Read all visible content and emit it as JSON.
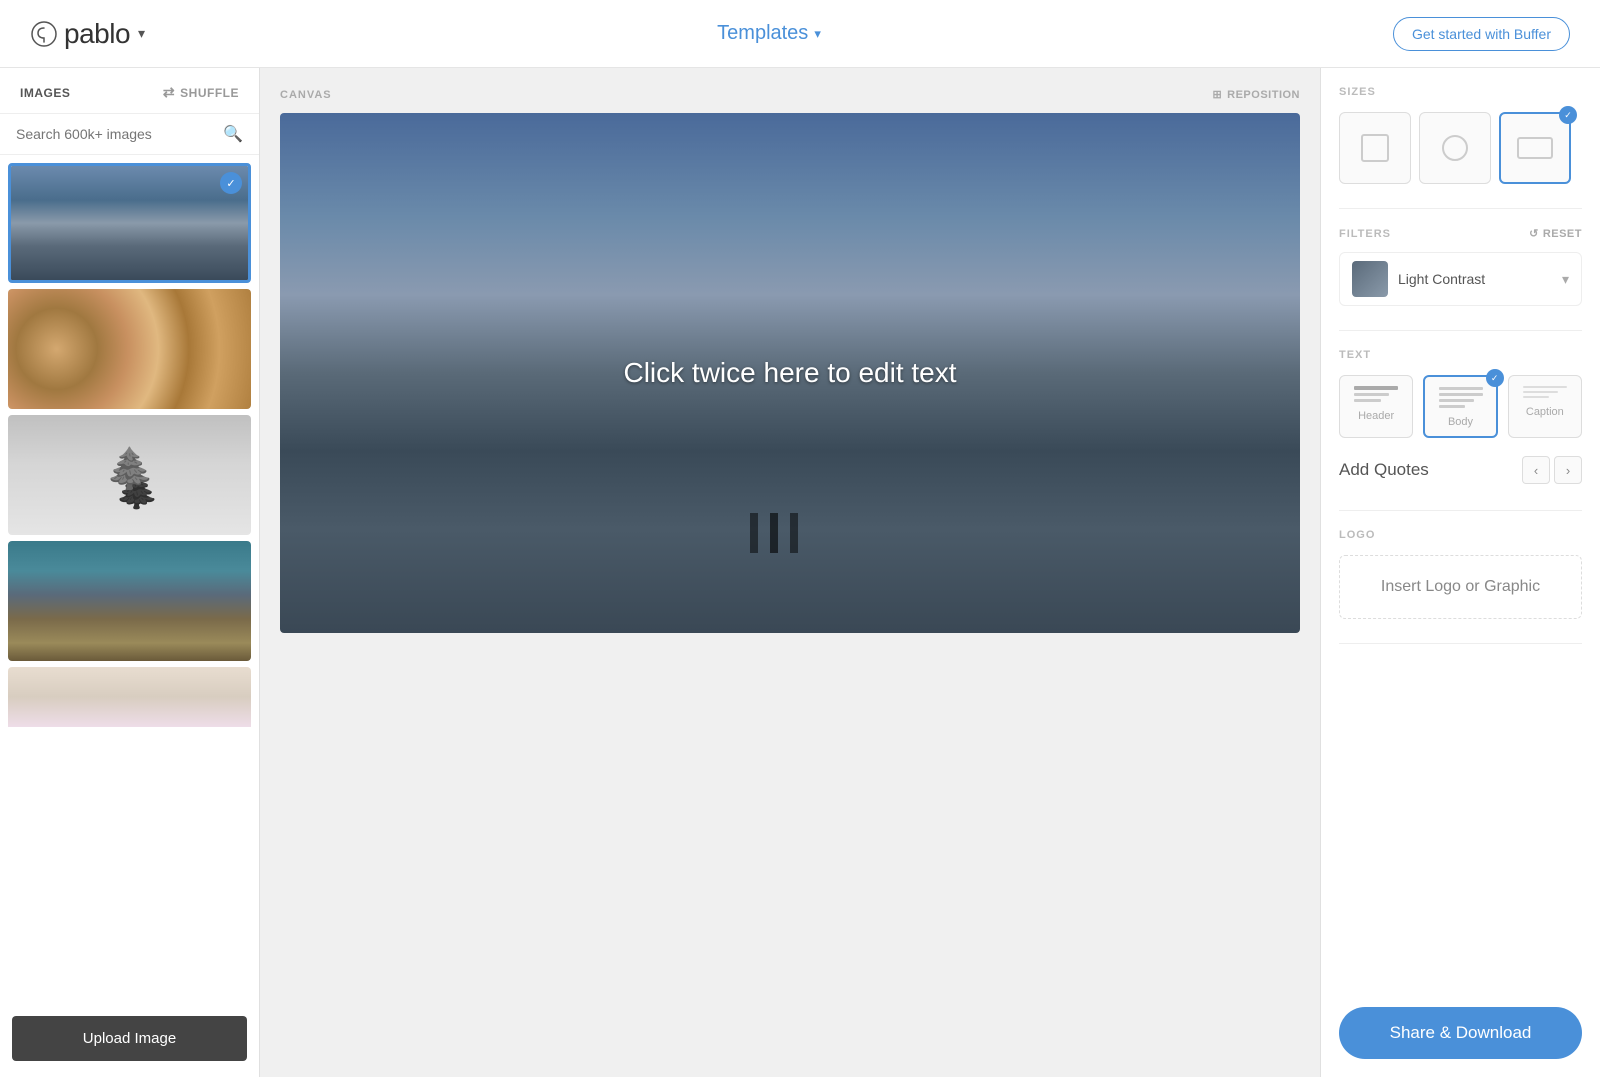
{
  "header": {
    "logo_text": "pablo",
    "templates_label": "Templates",
    "get_started_label": "Get started with Buffer"
  },
  "sidebar": {
    "images_tab": "IMAGES",
    "shuffle_label": "SHUFFLE",
    "search_placeholder": "Search 600k+ images",
    "upload_label": "Upload Image",
    "images": [
      {
        "id": "beach",
        "selected": true,
        "css_class": "img-beach"
      },
      {
        "id": "logs",
        "selected": false,
        "css_class": "img-logs"
      },
      {
        "id": "winter",
        "selected": false,
        "css_class": "img-winter"
      },
      {
        "id": "peeling",
        "selected": false,
        "css_class": "img-peeling"
      },
      {
        "id": "stones",
        "selected": false,
        "css_class": "img-stones"
      }
    ]
  },
  "canvas": {
    "label": "CANVAS",
    "reposition_label": "REPOSITION",
    "edit_text": "Click twice here to edit text"
  },
  "right_panel": {
    "sizes_title": "SIZES",
    "sizes": [
      {
        "id": "pinterest-sq",
        "selected": false,
        "type": "square"
      },
      {
        "id": "pinterest-sm",
        "selected": false,
        "type": "circle"
      },
      {
        "id": "facebook-twitter",
        "selected": true,
        "type": "wide"
      }
    ],
    "filters_title": "FILTERS",
    "reset_label": "RESET",
    "filter_name": "Light Contrast",
    "text_title": "TEXT",
    "text_options": [
      {
        "id": "header",
        "label": "Header",
        "selected": false
      },
      {
        "id": "body",
        "label": "Body",
        "selected": true
      },
      {
        "id": "caption",
        "label": "Caption",
        "selected": false
      }
    ],
    "add_quotes_label": "Add Quotes",
    "quote_prev": "‹",
    "quote_next": "›",
    "logo_title": "LOGO",
    "insert_logo_label": "Insert Logo or Graphic",
    "share_label": "Share & Download"
  }
}
